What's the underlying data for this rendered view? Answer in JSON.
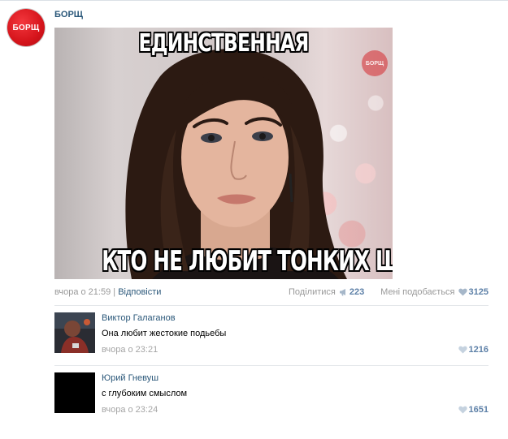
{
  "community": {
    "avatar_label": "БОРЩ",
    "name": "БОРЩ",
    "brand_color": "#d5141b"
  },
  "post": {
    "image": {
      "caption_top": "ЕДИНСТВЕННАЯ",
      "caption_bottom": "КТО НЕ ЛЮБИТ ТОНКИХ ШУТОК",
      "watermark": "БОРЩ"
    },
    "date": "вчора о 21:59",
    "separator": "|",
    "reply_label": "Відповісти",
    "share_label": "Поділитися",
    "share_icon": "megaphone-icon",
    "share_count": "223",
    "like_label": "Мені подобається",
    "like_icon": "heart-icon",
    "like_count": "3125"
  },
  "comments": [
    {
      "author": "Виктор Галаганов",
      "text": "Она любит жестокие подьебы",
      "date": "вчора о 23:21",
      "likes": "1216"
    },
    {
      "author": "Юрий Гневуш",
      "text": "с глубоким смыслом",
      "date": "вчора о 23:24",
      "likes": "1651"
    }
  ],
  "colors": {
    "link": "#2b587a",
    "count": "#5e81a8",
    "muted": "#999999",
    "divider": "#e4e7ea"
  }
}
